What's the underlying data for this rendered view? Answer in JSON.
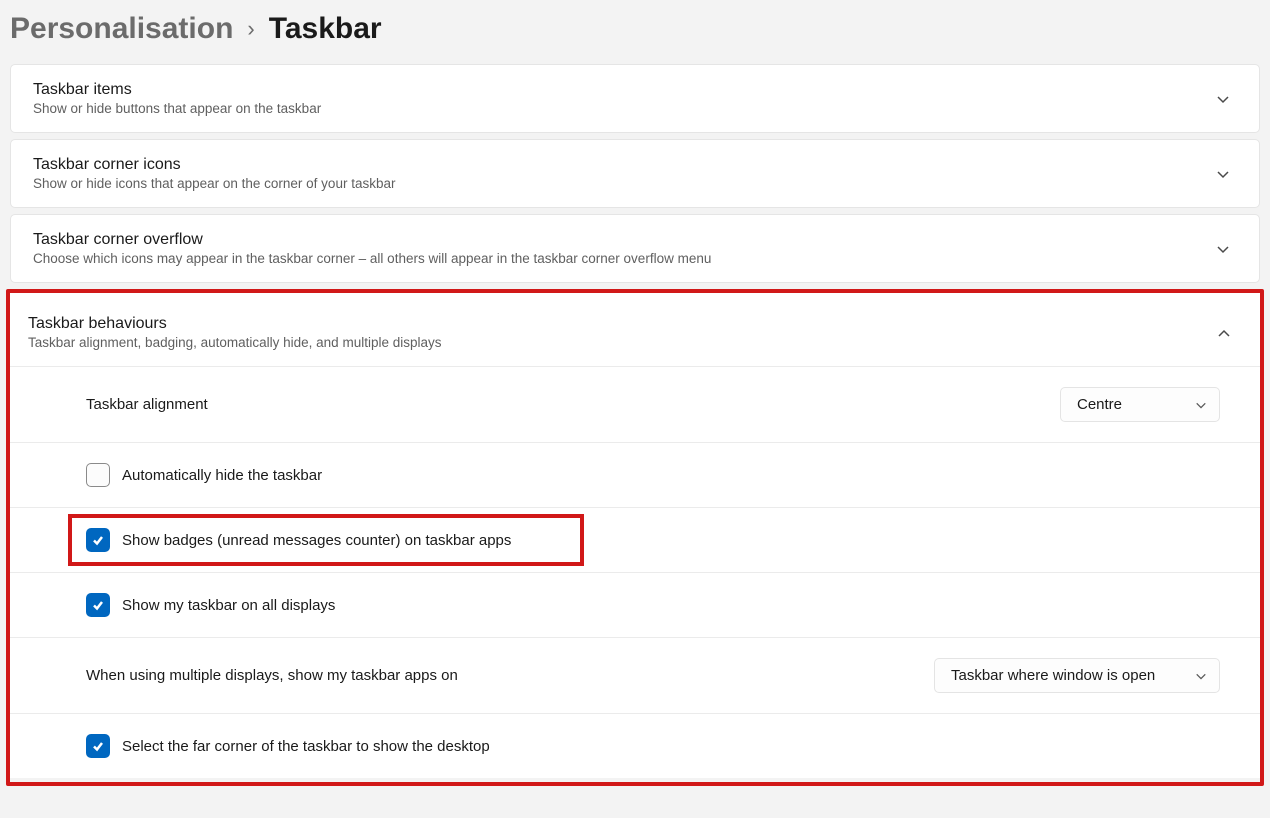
{
  "breadcrumb": {
    "parent": "Personalisation",
    "separator": "›",
    "current": "Taskbar"
  },
  "sections": {
    "items": {
      "title": "Taskbar items",
      "desc": "Show or hide buttons that appear on the taskbar"
    },
    "cornerIcons": {
      "title": "Taskbar corner icons",
      "desc": "Show or hide icons that appear on the corner of your taskbar"
    },
    "cornerOverflow": {
      "title": "Taskbar corner overflow",
      "desc": "Choose which icons may appear in the taskbar corner – all others will appear in the taskbar corner overflow menu"
    },
    "behaviours": {
      "title": "Taskbar behaviours",
      "desc": "Taskbar alignment, badging, automatically hide, and multiple displays",
      "settings": {
        "alignment": {
          "label": "Taskbar alignment",
          "value": "Centre"
        },
        "autohide": {
          "label": "Automatically hide the taskbar",
          "checked": false
        },
        "badges": {
          "label": "Show badges (unread messages counter) on taskbar apps",
          "checked": true
        },
        "allDisplays": {
          "label": "Show my taskbar on all displays",
          "checked": true
        },
        "multiDisplays": {
          "label": "When using multiple displays, show my taskbar apps on",
          "value": "Taskbar where window is open"
        },
        "farCorner": {
          "label": "Select the far corner of the taskbar to show the desktop",
          "checked": true
        }
      }
    }
  }
}
